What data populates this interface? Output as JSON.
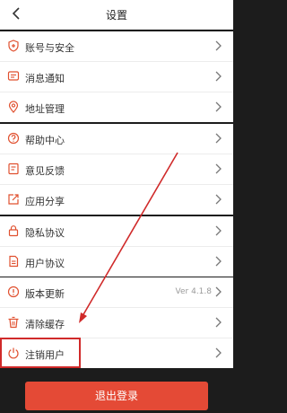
{
  "header": {
    "title": "设置",
    "back_icon": "chevron-left-icon"
  },
  "groups": [
    {
      "items": [
        {
          "label": "账号与安全",
          "icon": "shield-icon"
        },
        {
          "label": "消息通知",
          "icon": "message-icon"
        },
        {
          "label": "地址管理",
          "icon": "location-pin-icon"
        }
      ]
    },
    {
      "items": [
        {
          "label": "帮助中心",
          "icon": "help-icon"
        },
        {
          "label": "意见反馈",
          "icon": "feedback-icon"
        },
        {
          "label": "应用分享",
          "icon": "share-icon"
        }
      ]
    },
    {
      "items": [
        {
          "label": "隐私协议",
          "icon": "lock-icon"
        },
        {
          "label": "用户协议",
          "icon": "document-icon"
        }
      ]
    },
    {
      "items": [
        {
          "label": "版本更新",
          "icon": "info-icon",
          "value": "Ver 4.1.8"
        },
        {
          "label": "清除缓存",
          "icon": "trash-icon"
        },
        {
          "label": "注销用户",
          "icon": "power-icon"
        }
      ]
    }
  ],
  "logout_label": "退出登录",
  "colors": {
    "accent": "#e44a36",
    "icon": "#e0502f",
    "annotation": "#d02a2a"
  }
}
